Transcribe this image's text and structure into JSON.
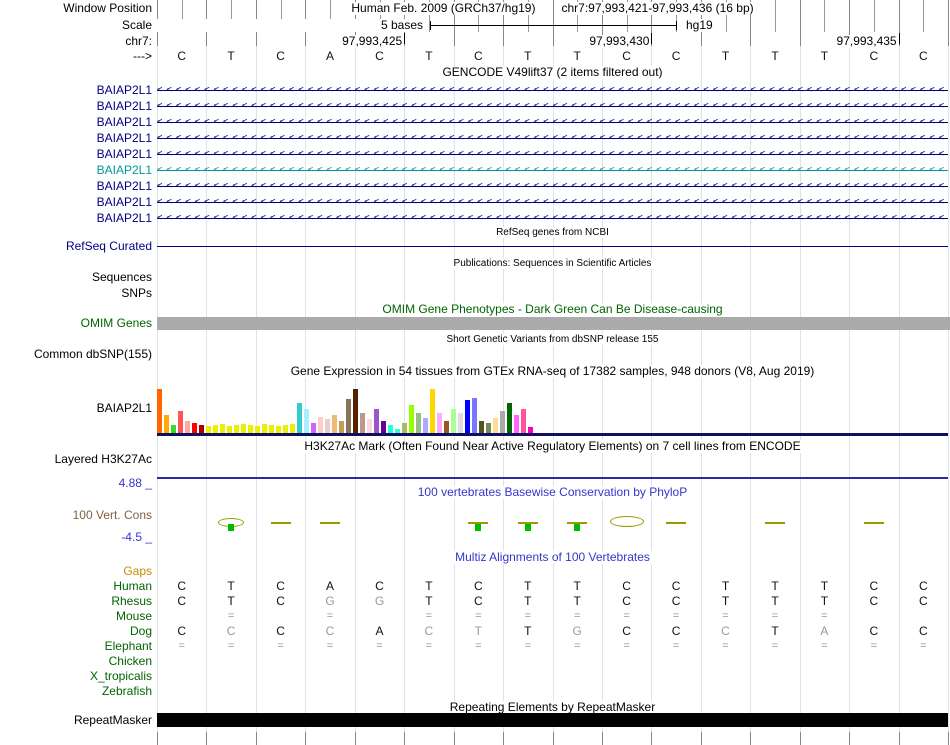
{
  "colors": {
    "track_navy": "#000080",
    "gene_alt_teal": "#009898",
    "omim_green": "#006400",
    "cons_blue": "#3535CC",
    "species_green": "#006400",
    "gaps_orange": "#CC8800",
    "phylop_olive": "#9A9A00",
    "phylop_green": "#00BB00",
    "omim_bar_gray": "#ABABAB",
    "repeat_black": "#000000",
    "vert_cons_brown": "#806040"
  },
  "header": {
    "window_position_label": "Window Position",
    "assembly_text": "Human Feb. 2009 (GRCh37/hg19)",
    "range_text": "chr7:97,993,421-97,993,436 (16 bp)",
    "scale_label": "Scale",
    "scale_value": "5 bases",
    "assembly_short": "hg19",
    "chrom_label": "chr7:",
    "strand_label": "--->",
    "coordinate_ticks": [
      "97,993,425",
      "97,993,430",
      "97,993,435"
    ],
    "bases": [
      "C",
      "T",
      "C",
      "A",
      "C",
      "T",
      "C",
      "T",
      "T",
      "C",
      "C",
      "T",
      "T",
      "T",
      "C",
      "C"
    ]
  },
  "gencode": {
    "title": "GENCODE V49lift37 (2 items filtered out)",
    "transcripts": [
      {
        "label": "BAIAP2L1",
        "color": "#000080"
      },
      {
        "label": "BAIAP2L1",
        "color": "#000080"
      },
      {
        "label": "BAIAP2L1",
        "color": "#000080"
      },
      {
        "label": "BAIAP2L1",
        "color": "#000080"
      },
      {
        "label": "BAIAP2L1",
        "color": "#000080"
      },
      {
        "label": "BAIAP2L1",
        "color": "#009898"
      },
      {
        "label": "BAIAP2L1",
        "color": "#000080"
      },
      {
        "label": "BAIAP2L1",
        "color": "#000080"
      },
      {
        "label": "BAIAP2L1",
        "color": "#000080"
      }
    ]
  },
  "refseq": {
    "title": "RefSeq genes from NCBI",
    "label": "RefSeq Curated"
  },
  "publications": {
    "title": "Publications: Sequences in Scientific Articles",
    "rows": [
      "Sequences",
      "SNPs"
    ]
  },
  "omim": {
    "title": "OMIM Gene Phenotypes - Dark Green Can Be Disease-causing",
    "label": "OMIM Genes"
  },
  "dbsnp": {
    "title": "Short Genetic Variants from dbSNP release 155",
    "label": "Common dbSNP(155)"
  },
  "gtex": {
    "title": "Gene Expression in 54 tissues from GTEx RNA-seq of 17382 samples, 948 donors (V8, Aug 2019)",
    "label": "BAIAP2L1"
  },
  "chart_data": {
    "type": "bar",
    "title": "Gene Expression in 54 tissues from GTEx RNA-seq of 17382 samples, 948 donors (V8, Aug 2019)",
    "series_label": "BAIAP2L1",
    "unit": "relative expression (bar height, px)",
    "values": [
      44,
      18,
      8,
      22,
      12,
      10,
      8,
      7,
      8,
      9,
      7,
      8,
      9,
      8,
      7,
      9,
      8,
      7,
      8,
      9,
      30,
      24,
      10,
      16,
      14,
      18,
      12,
      34,
      44,
      20,
      14,
      24,
      12,
      8,
      4,
      10,
      28,
      20,
      15,
      44,
      20,
      12,
      24,
      20,
      33,
      35,
      12,
      10,
      15,
      22,
      30,
      18,
      24,
      6
    ],
    "colors": [
      "#FF6600",
      "#FFAA00",
      "#33DD33",
      "#FF5555",
      "#FFAA99",
      "#FF0000",
      "#AA0000",
      "#EEEE00",
      "#EEEE00",
      "#EEEE00",
      "#EEEE00",
      "#EEEE00",
      "#EEEE00",
      "#EEEE00",
      "#EEEE00",
      "#EEEE00",
      "#EEEE00",
      "#EEEE00",
      "#EEEE00",
      "#EEEE00",
      "#33CCCC",
      "#AAEEFF",
      "#CC66FF",
      "#FFCCCC",
      "#EECCCC",
      "#EEBB77",
      "#CC9955",
      "#8B7355",
      "#552200",
      "#BB9988",
      "#FFD9D9",
      "#9955CC",
      "#660099",
      "#22FFDD",
      "#33FFC2",
      "#AABB66",
      "#99FF00",
      "#99BB88",
      "#AAAAFF",
      "#FFD700",
      "#FFAAFF",
      "#995522",
      "#AAFF99",
      "#DDDDDD",
      "#0000FF",
      "#7777FF",
      "#555522",
      "#778855",
      "#FFDD99",
      "#AAAAAA",
      "#006600",
      "#FF66FF",
      "#FF5599",
      "#FF00BB"
    ]
  },
  "h3k27ac": {
    "title": "H3K27Ac Mark (Often Found Near Active Regulatory Elements) on 7 cell lines from ENCODE",
    "label": "Layered H3K27Ac"
  },
  "conservation": {
    "title": "100 vertebrates Basewise Conservation by PhyloP",
    "label": "100 Vert. Cons",
    "max_label": "4.88 _",
    "min_label": "-4.5 _",
    "marks": [
      {
        "col": 1,
        "type": "ellipse"
      },
      {
        "col": 1,
        "type": "bar"
      },
      {
        "col": 2,
        "type": "dash"
      },
      {
        "col": 3,
        "type": "dash"
      },
      {
        "col": 6,
        "type": "dash"
      },
      {
        "col": 6,
        "type": "bar"
      },
      {
        "col": 7,
        "type": "dash"
      },
      {
        "col": 7,
        "type": "bar"
      },
      {
        "col": 8,
        "type": "dash"
      },
      {
        "col": 8,
        "type": "bar"
      },
      {
        "col": 9,
        "type": "ellipse2"
      },
      {
        "col": 10,
        "type": "dash"
      },
      {
        "col": 12,
        "type": "dash"
      },
      {
        "col": 14,
        "type": "dash"
      }
    ]
  },
  "multiz": {
    "title": "Multiz Alignments of 100 Vertebrates",
    "gaps_label": "Gaps",
    "species": [
      {
        "name": "Human",
        "tokens": [
          "C",
          "T",
          "C",
          "A",
          "C",
          "T",
          "C",
          "T",
          "T",
          "C",
          "C",
          "T",
          "T",
          "T",
          "C",
          "C"
        ]
      },
      {
        "name": "Rhesus",
        "tokens": [
          "C",
          "T",
          "C",
          "G*",
          "G*",
          "T",
          "C",
          "T",
          "T",
          "C",
          "C",
          "T",
          "T",
          "T",
          "C",
          "C"
        ]
      },
      {
        "name": "Mouse",
        "tokens": [
          "",
          "=",
          "",
          "=",
          "",
          "=",
          "=",
          "=",
          "=",
          "=",
          "=",
          "=",
          "=",
          "=",
          "",
          ""
        ]
      },
      {
        "name": "Dog",
        "tokens": [
          "C",
          "C*",
          "C",
          "C*",
          "A",
          "C*",
          "T*",
          "T",
          "G*",
          "C",
          "C",
          "C*",
          "T",
          "A*",
          "C",
          "C"
        ]
      },
      {
        "name": "Elephant",
        "tokens": [
          "=",
          "=",
          "=",
          "=",
          "=",
          "=",
          "=",
          "=",
          "=",
          "=",
          "=",
          "=",
          "=",
          "=",
          "=",
          "="
        ]
      },
      {
        "name": "Chicken",
        "tokens": [
          "",
          "",
          "",
          "",
          "",
          "",
          "",
          "",
          "",
          "",
          "",
          "",
          "",
          "",
          "",
          ""
        ]
      },
      {
        "name": "X_tropicalis",
        "tokens": [
          "",
          "",
          "",
          "",
          "",
          "",
          "",
          "",
          "",
          "",
          "",
          "",
          "",
          "",
          "",
          ""
        ]
      },
      {
        "name": "Zebrafish",
        "tokens": [
          "",
          "",
          "",
          "",
          "",
          "",
          "",
          "",
          "",
          "",
          "",
          "",
          "",
          "",
          "",
          ""
        ]
      }
    ]
  },
  "repeatmasker": {
    "title": "Repeating Elements by RepeatMasker",
    "label": "RepeatMasker"
  }
}
